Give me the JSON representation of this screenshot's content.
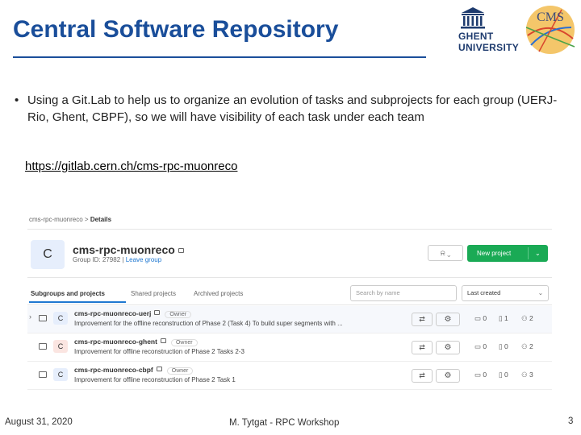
{
  "slide": {
    "title": "Central Software Repository",
    "bullet": "Using a Git.Lab to help us to organize an evolution of tasks and subprojects for each group (UERJ-Rio, Ghent, CBPF), so we will have visibility of each task under each team",
    "link": "https://gitlab.cern.ch/cms-rpc-muonreco",
    "ghent_logo_text": [
      "GHENT",
      "UNIVERSITY"
    ],
    "cms_logo_text": "CMS",
    "footer_date": "August 31, 2020",
    "footer_center": "M. Tytgat - RPC Workshop",
    "page_number": "3"
  },
  "gitlab": {
    "breadcrumb_group": "cms-rpc-muonreco",
    "breadcrumb_sep": ">",
    "breadcrumb_current": "Details",
    "avatar_letter": "C",
    "group_name": "cms-rpc-muonreco",
    "group_id": "Group ID: 27982",
    "leave_group": "Leave group",
    "notification_label": "⍾ ⌄",
    "new_project_label": "New project",
    "tabs": [
      "Subgroups and projects",
      "Shared projects",
      "Archived projects"
    ],
    "search_placeholder": "Search by name",
    "sort_label": "Last created",
    "rows": [
      {
        "letter": "C",
        "name": "cms-rpc-muonreco-uerj",
        "role": "Owner",
        "desc": "Improvement for the offline reconstruction of Phase 2 (Task 4) To build super segments with ...",
        "folders": "0",
        "projects": "1",
        "members": "2",
        "avatar_color": "#e6eefc"
      },
      {
        "letter": "C",
        "name": "cms-rpc-muonreco-ghent",
        "role": "Owner",
        "desc": "Improvement for offline reconstruction of Phase 2 Tasks 2-3",
        "folders": "0",
        "projects": "0",
        "members": "2",
        "avatar_color": "#fbe5e1"
      },
      {
        "letter": "C",
        "name": "cms-rpc-muonreco-cbpf",
        "role": "Owner",
        "desc": "Improvement for offline reconstruction of Phase 2 Task 1",
        "folders": "0",
        "projects": "0",
        "members": "3",
        "avatar_color": "#e6eefc"
      }
    ]
  }
}
